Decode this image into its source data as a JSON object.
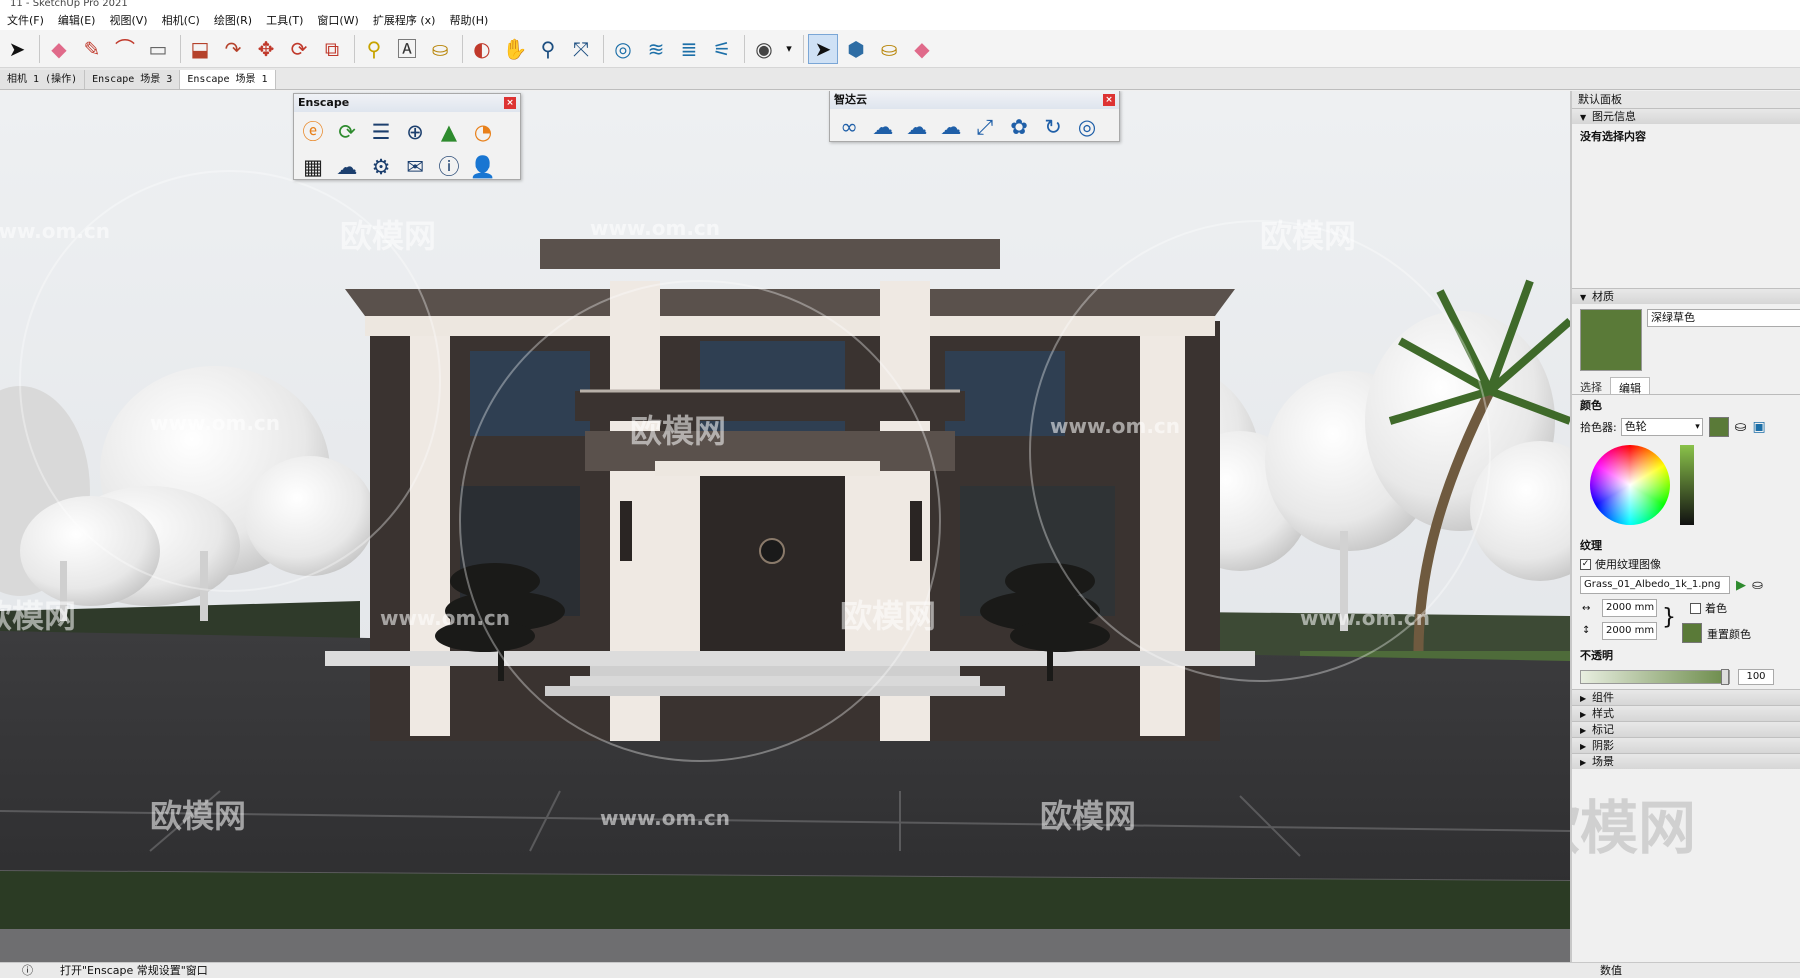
{
  "window": {
    "title": "11 - SketchUp Pro 2021"
  },
  "menu": [
    "文件(F)",
    "编辑(E)",
    "视图(V)",
    "相机(C)",
    "绘图(R)",
    "工具(T)",
    "窗口(W)",
    "扩展程序 (x)",
    "帮助(H)"
  ],
  "scene_tabs": [
    {
      "label": "相机 1 (操作)",
      "active": false
    },
    {
      "label": "Enscape 场景 3",
      "active": false
    },
    {
      "label": "Enscape 场景 1",
      "active": true
    }
  ],
  "enscape_panel": {
    "title": "Enscape"
  },
  "zhidayun_panel": {
    "title": "智达云"
  },
  "tray": {
    "title": "默认面板",
    "entity_info": {
      "header": "图元信息",
      "text": "没有选择内容"
    },
    "materials": {
      "header": "材质",
      "material_name": "深绿草色",
      "tabs": [
        "选择",
        "编辑"
      ],
      "color_label": "颜色",
      "picker_label": "拾色器:",
      "picker_value": "色轮",
      "texture_label": "纹理",
      "use_texture_label": "使用纹理图像",
      "texture_file": "Grass_01_Albedo_1k_1.png",
      "width": "2000 mm",
      "height": "2000 mm",
      "colorize_label": "着色",
      "reset_color_label": "重置颜色",
      "opacity_label": "不透明",
      "opacity_value": "100",
      "swatch_color": "#5a7a38"
    },
    "collapsed_sections": [
      "组件",
      "样式",
      "标记",
      "阴影",
      "场景"
    ]
  },
  "status": {
    "text": "打开\"Enscape 常规设置\"窗口",
    "right": "数值"
  },
  "watermark": {
    "brand": "欧模网",
    "url": "www.om.cn"
  }
}
